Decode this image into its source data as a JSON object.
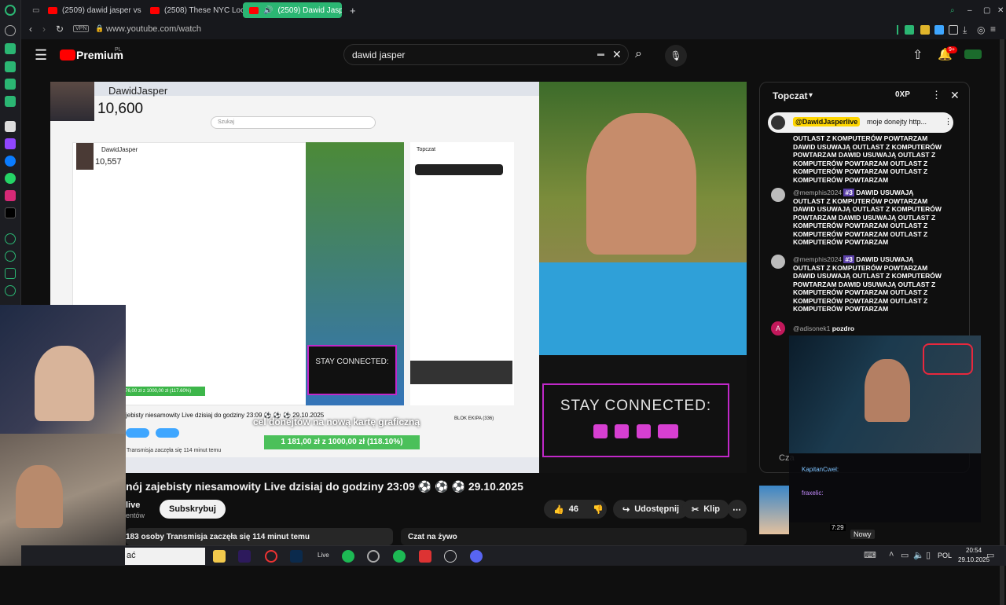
{
  "browser": {
    "tabs": [
      {
        "label": "(2509) dawid jasper vs w"
      },
      {
        "label": "(2508) These NYC Locati"
      },
      {
        "label": "(2509) Dawid Jasper"
      }
    ],
    "vpn": "VPN",
    "url": "www.youtube.com/watch",
    "accent": "#2bb673"
  },
  "youtube": {
    "brand": "Premium",
    "region": "PL",
    "search_query": "dawid jasper",
    "notif_count": "9+"
  },
  "video": {
    "overlay_name": "DawidJasper",
    "overlay_count": "10,600",
    "inner_name": "DawidJasper",
    "inner_count": "10,557",
    "stay_connected": "STAY CONNECTED:",
    "subtitle": "cel donejtów na nową kartę graficzną",
    "goal_text": "1 181,00 zł z 1000,00 zł (118.10%)",
    "inner_goal": "1 176,00 zł z 1000,00 zł (117.60%)",
    "inner_search": "Szukaj",
    "inner_title": "jebisty niesamowity Live dzisiaj do godziny 23:09 ⚽ ⚽ ⚽ 29.10.2025",
    "inner_chat_header": "Topczat",
    "inner_live_badge": "Transmisja zaczęła się 114 minut temu",
    "inner_card": "BLOK EKIPA (336)"
  },
  "chat": {
    "header": "Topczat",
    "xp": "0XP",
    "pinned_author": "@DawidJasperlive",
    "pinned_text": "moje donejty http...",
    "pinned_body": "OUTLAST Z KOMPUTERÓW POWTARZAM DAWID USUWAJĄ OUTLAST Z KOMPUTERÓW POWTARZAM DAWID USUWAJĄ OUTLAST Z KOMPUTERÓW POWTARZAM OUTLAST Z KOMPUTERÓW POWTARZAM OUTLAST Z KOMPUTERÓW POWTARZAM",
    "messages": [
      {
        "author": "@memphis2024",
        "badge": "#3",
        "text": "DAWID USUWAJĄ OUTLAST Z KOMPUTERÓW POWTARZAM DAWID USUWAJĄ OUTLAST Z KOMPUTERÓW POWTARZAM DAWID USUWAJĄ OUTLAST Z KOMPUTERÓW POWTARZAM OUTLAST Z KOMPUTERÓW POWTARZAM OUTLAST Z KOMPUTERÓW POWTARZAM"
      },
      {
        "author": "@memphis2024",
        "badge": "#3",
        "text": "DAWID USUWAJĄ OUTLAST Z KOMPUTERÓW POWTARZAM DAWID USUWAJĄ OUTLAST Z KOMPUTERÓW POWTARZAM DAWID USUWAJĄ OUTLAST Z KOMPUTERÓW POWTARZAM OUTLAST Z KOMPUTERÓW POWTARZAM OUTLAST Z KOMPUTERÓW POWTARZAM"
      },
      {
        "author": "@adisonek1",
        "text": "pozdro",
        "avatar": "A"
      }
    ],
    "input_prefix": "Cza",
    "overlay_users": [
      "KapitanCwel:",
      "fraxelic:"
    ],
    "new_label": "Nowy",
    "thumb_time": "7:29"
  },
  "below": {
    "title": "nój zajebisty niesamowity Live dzisiaj do godziny 23:09 ⚽ ⚽ ⚽ 29.10.2025",
    "channel": "live",
    "subs": "entów",
    "subscribe": "Subskrybuj",
    "likes": "46",
    "share": "Udostępnij",
    "clip": "Klip",
    "viewers": "183 osoby  Transmisja zaczęła się 114 minut temu",
    "live_chat": "Czat na żywo",
    "left_text": "ać"
  },
  "taskbar": {
    "lang": "POL",
    "time": "20:54",
    "date": "29.10.2025",
    "live_label": "Live"
  }
}
